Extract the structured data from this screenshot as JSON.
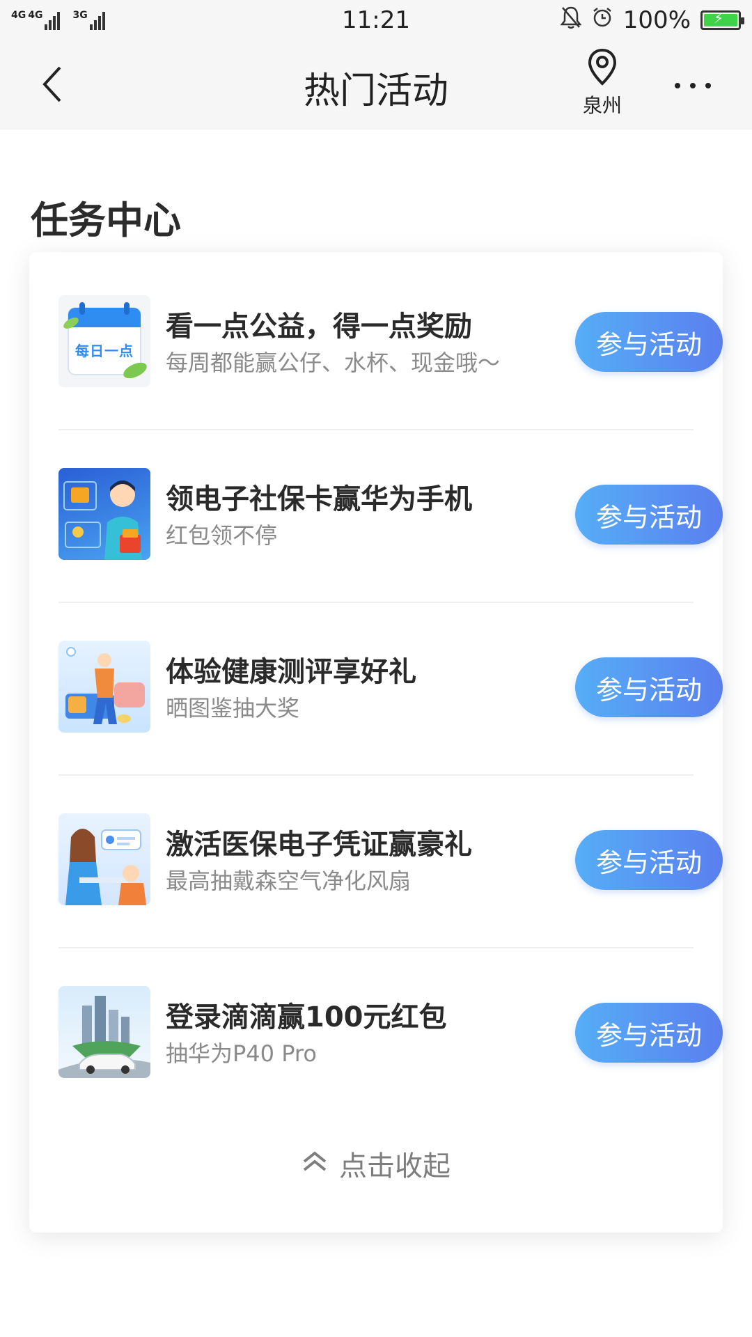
{
  "status_bar": {
    "network_1": "4G",
    "network_2": "4G",
    "network_3": "3G",
    "time": "11:21",
    "battery": "100%",
    "icons": [
      "bell-off-icon",
      "alarm-icon",
      "battery-charging-icon"
    ]
  },
  "nav": {
    "title": "热门活动",
    "city": "泉州",
    "icons": {
      "back": "chevron-left-icon",
      "location": "location-pin-icon",
      "more": "more-dots-icon"
    }
  },
  "section": {
    "title": "任务中心"
  },
  "tasks": [
    {
      "title": "看一点公益，得一点奖励",
      "subtitle": "每周都能赢公仔、水杯、现金哦～",
      "button": "参与活动",
      "thumb_text": "每日一点"
    },
    {
      "title": "领电子社保卡赢华为手机",
      "subtitle": "红包领不停",
      "button": "参与活动"
    },
    {
      "title": "体验健康测评享好礼",
      "subtitle": "晒图鉴抽大奖",
      "button": "参与活动"
    },
    {
      "title": "激活医保电子凭证赢豪礼",
      "subtitle": "最高抽戴森空气净化风扇",
      "button": "参与活动"
    },
    {
      "title": "登录滴滴赢100元红包",
      "subtitle": "抽华为P40 Pro",
      "button": "参与活动"
    }
  ],
  "collapse": {
    "label": "点击收起",
    "icon": "double-chevron-up-icon"
  },
  "colors": {
    "button_start": "#56aef6",
    "button_end": "#5a7fef",
    "subtitle": "#8a8a8a"
  }
}
